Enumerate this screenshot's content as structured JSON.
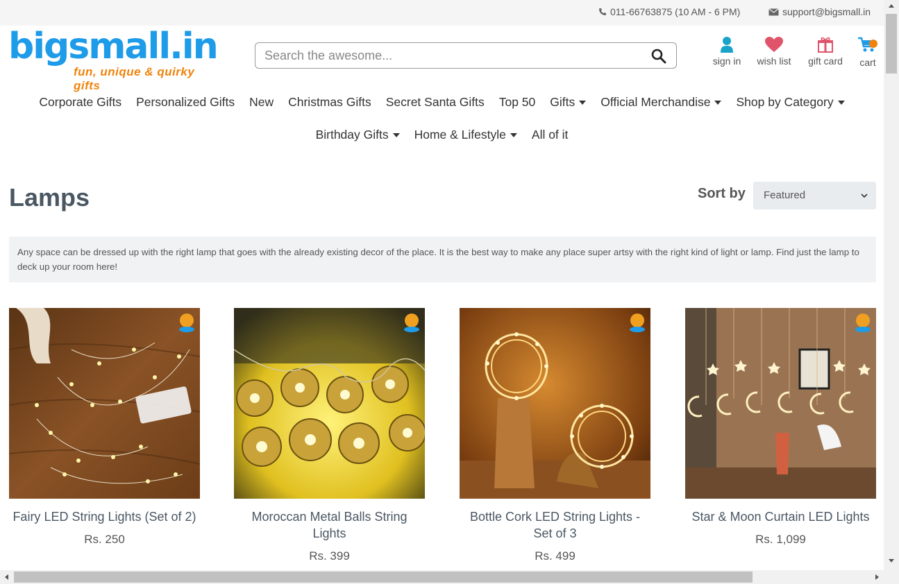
{
  "topbar": {
    "phone": "011-66763875 (10 AM - 6 PM)",
    "email": "support@bigsmall.in"
  },
  "logo": {
    "brand": "bigsmall.in",
    "tagline": "fun, unique & quirky gifts"
  },
  "search": {
    "placeholder": "Search the awesome..."
  },
  "header_actions": [
    {
      "label": "sign in",
      "icon": "user-icon"
    },
    {
      "label": "wish list",
      "icon": "heart-icon"
    },
    {
      "label": "gift card",
      "icon": "gift-icon"
    },
    {
      "label": "cart",
      "icon": "cart-icon"
    }
  ],
  "nav": {
    "row1": [
      {
        "label": "Corporate Gifts",
        "dropdown": false
      },
      {
        "label": "Personalized Gifts",
        "dropdown": false
      },
      {
        "label": "New",
        "dropdown": false
      },
      {
        "label": "Christmas Gifts",
        "dropdown": false
      },
      {
        "label": "Secret Santa Gifts",
        "dropdown": false
      },
      {
        "label": "Top 50",
        "dropdown": false
      },
      {
        "label": "Gifts",
        "dropdown": true
      },
      {
        "label": "Official Merchandise",
        "dropdown": true
      },
      {
        "label": "Shop by Category",
        "dropdown": true
      }
    ],
    "row2": [
      {
        "label": "Birthday Gifts",
        "dropdown": true
      },
      {
        "label": "Home & Lifestyle",
        "dropdown": true
      },
      {
        "label": "All of it",
        "dropdown": false
      }
    ]
  },
  "page": {
    "title": "Lamps",
    "sort_label": "Sort by",
    "sort_value": "Featured",
    "description": "Any space can be dressed up with the right lamp that goes with the already existing decor of the place. It is the best way to make any place super artsy with the right kind of light or lamp. Find just the lamp to deck up your room here!"
  },
  "products": [
    {
      "name": "Fairy LED String Lights (Set of 2)",
      "price": "Rs. 250"
    },
    {
      "name": "Moroccan Metal Balls String Lights",
      "price": "Rs. 399"
    },
    {
      "name": "Bottle Cork LED String Lights - Set of 3",
      "price": "Rs. 499"
    },
    {
      "name": "Star & Moon Curtain LED Lights",
      "price": "Rs. 1,099"
    }
  ],
  "colors": {
    "brand_blue": "#1e9be9",
    "brand_orange": "#f0830c",
    "wishlist_red": "#e0546b",
    "signin_teal": "#1aa3c8"
  }
}
